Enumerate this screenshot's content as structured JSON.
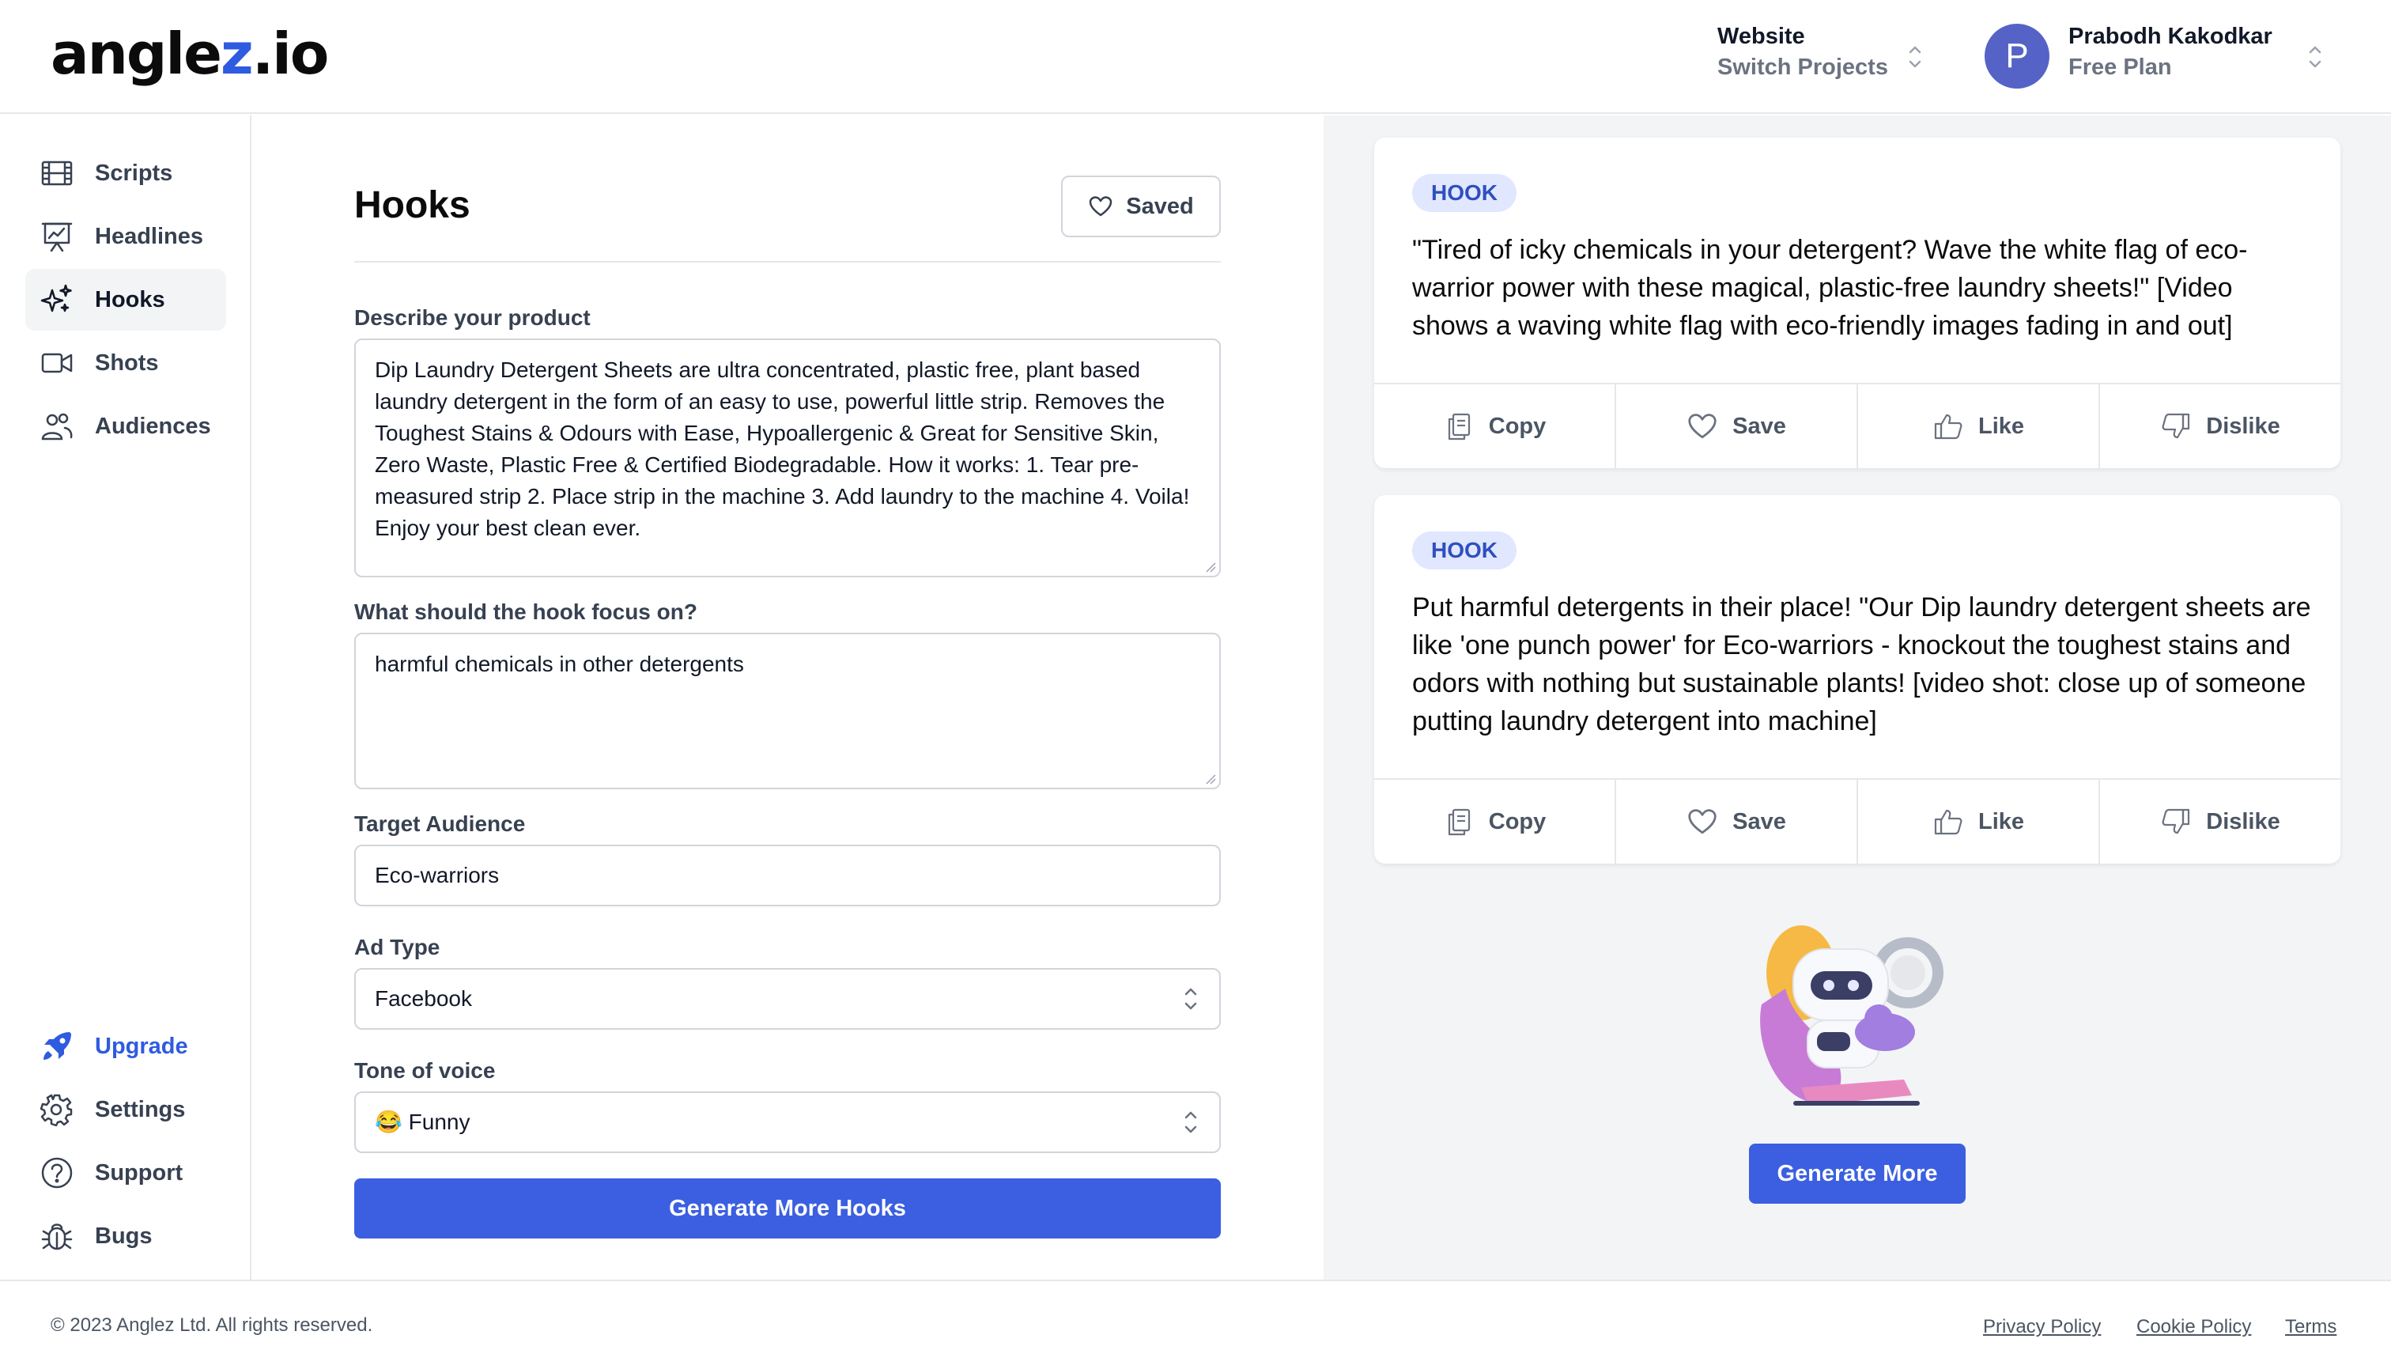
{
  "header": {
    "logo_prefix": "angle",
    "logo_z": "z",
    "logo_suffix": ".io",
    "project_label": "Website",
    "project_action": "Switch Projects",
    "avatar_initial": "P",
    "user_name": "Prabodh Kakodkar",
    "user_plan": "Free Plan"
  },
  "sidebar": {
    "items": [
      {
        "label": "Scripts",
        "icon": "film-icon"
      },
      {
        "label": "Headlines",
        "icon": "presentation-chart-icon"
      },
      {
        "label": "Hooks",
        "icon": "sparkles-icon",
        "active": true
      },
      {
        "label": "Shots",
        "icon": "video-camera-icon"
      },
      {
        "label": "Audiences",
        "icon": "users-icon"
      }
    ],
    "bottom_items": [
      {
        "label": "Upgrade",
        "icon": "rocket-icon"
      },
      {
        "label": "Settings",
        "icon": "gear-icon"
      },
      {
        "label": "Support",
        "icon": "question-circle-icon"
      },
      {
        "label": "Bugs",
        "icon": "bug-icon"
      }
    ]
  },
  "form": {
    "title": "Hooks",
    "saved_label": "Saved",
    "product_label": "Describe your product",
    "product_value": "Dip Laundry Detergent Sheets are ultra concentrated, plastic free, plant based laundry detergent in the form of an easy to use, powerful little strip. Removes the Toughest Stains & Odours with Ease, Hypoallergenic & Great for Sensitive Skin, Zero Waste, Plastic Free & Certified Biodegradable. How it works:  1. Tear pre-measured strip 2. Place strip in the machine 3. Add laundry to the machine 4. Voila! Enjoy your best clean ever.",
    "focus_label": "What should the hook focus on?",
    "focus_value": "harmful chemicals in other detergents",
    "audience_label": "Target Audience",
    "audience_value": "Eco-warriors",
    "adtype_label": "Ad Type",
    "adtype_value": "Facebook",
    "tone_label": "Tone of voice",
    "tone_value": "😂 Funny",
    "generate_label": "Generate More Hooks"
  },
  "results": {
    "cards": [
      {
        "badge": "HOOK",
        "text": "\"Tired of icky chemicals in your detergent? Wave the white flag of eco-warrior power with these magical, plastic-free laundry sheets!\" [Video shows a waving white flag with eco-friendly images fading in and out]"
      },
      {
        "badge": "HOOK",
        "text": "Put harmful detergents in their place! \"Our Dip laundry detergent sheets are like 'one punch power' for Eco-warriors - knockout the toughest stains and odors with nothing but sustainable plants! [video shot: close up of someone putting laundry detergent into machine]"
      }
    ],
    "actions": {
      "copy": "Copy",
      "save": "Save",
      "like": "Like",
      "dislike": "Dislike"
    },
    "generate_more": "Generate More"
  },
  "footer": {
    "copyright": "© 2023 Anglez Ltd. All rights reserved.",
    "privacy": "Privacy Policy",
    "cookie": "Cookie Policy",
    "terms": "Terms"
  },
  "colors": {
    "accent": "#3b5fe0",
    "badge_bg": "#e0e7ff",
    "panel_bg": "#f3f4f6"
  }
}
